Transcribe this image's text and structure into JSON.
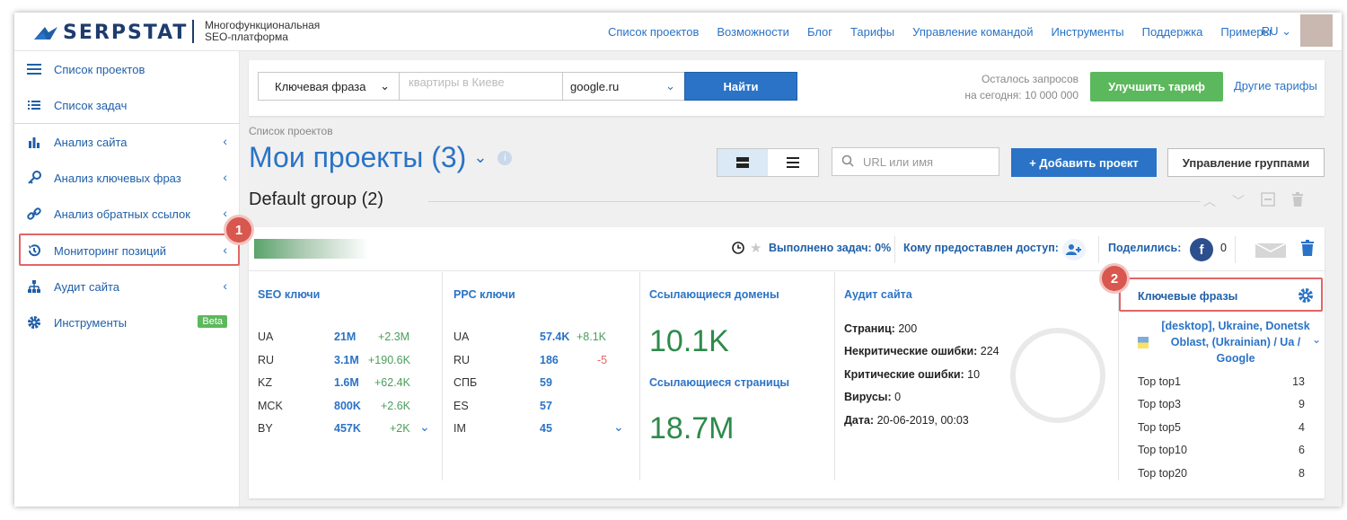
{
  "header": {
    "logo": "SERPSTAT",
    "subtitle_line1": "Многофункциональная",
    "subtitle_line2": "SEO-платформа",
    "nav": [
      "Список проектов",
      "Возможности",
      "Блог",
      "Тарифы",
      "Управление командой",
      "Инструменты",
      "Поддержка",
      "Примеры"
    ],
    "lang": "RU"
  },
  "sidebar": {
    "items": [
      {
        "label": "Список проектов",
        "icon": "menu-icon"
      },
      {
        "label": "Список задач",
        "icon": "list-icon"
      },
      {
        "label": "Анализ сайта",
        "icon": "chart-icon"
      },
      {
        "label": "Анализ ключевых фраз",
        "icon": "key-icon"
      },
      {
        "label": "Анализ обратных ссылок",
        "icon": "link-icon"
      },
      {
        "label": "Мониторинг позиций",
        "icon": "history-icon"
      },
      {
        "label": "Аудит сайта",
        "icon": "sitemap-icon"
      },
      {
        "label": "Инструменты",
        "icon": "gear-icon"
      }
    ],
    "beta": "Beta"
  },
  "annotations": {
    "one": "1",
    "two": "2"
  },
  "search": {
    "type": "Ключевая фраза",
    "placeholder": "квартиры в Киеве",
    "engine": "google.ru",
    "find": "Найти",
    "quota_line1": "Осталось запросов",
    "quota_line2": "на сегодня: 10 000 000",
    "upgrade": "Улучшить тариф",
    "other": "Другие тарифы"
  },
  "page": {
    "breadcrumb": "Список проектов",
    "title": "Мои проекты (3)",
    "url_placeholder": "URL или имя",
    "add_project": "+ Добавить проект",
    "manage_groups": "Управление группами",
    "group_title": "Default group (2)"
  },
  "project": {
    "tasks": "Выполнено задач: 0%",
    "access": "Кому предоставлен доступ:",
    "shared": "Поделились:",
    "share_count": "0",
    "seo": {
      "title": "SEO ключи",
      "rows": [
        {
          "c": "UA",
          "v": "21M",
          "d": "+2.3M"
        },
        {
          "c": "RU",
          "v": "3.1M",
          "d": "+190.6K"
        },
        {
          "c": "KZ",
          "v": "1.6M",
          "d": "+62.4K"
        },
        {
          "c": "MCK",
          "v": "800K",
          "d": "+2.6K"
        },
        {
          "c": "BY",
          "v": "457K",
          "d": "+2K"
        }
      ]
    },
    "ppc": {
      "title": "PPC ключи",
      "rows": [
        {
          "c": "UA",
          "v": "57.4K",
          "d": "+8.1K"
        },
        {
          "c": "RU",
          "v": "186",
          "d": "-5"
        },
        {
          "c": "СПБ",
          "v": "59",
          "d": ""
        },
        {
          "c": "ES",
          "v": "57",
          "d": ""
        },
        {
          "c": "IM",
          "v": "45",
          "d": ""
        }
      ]
    },
    "links": {
      "domains_title": "Ссылающиеся домены",
      "domains_value": "10.1K",
      "pages_title": "Ссылающиеся страницы",
      "pages_value": "18.7M"
    },
    "audit": {
      "title": "Аудит сайта",
      "pages_l": "Страниц:",
      "pages_v": "200",
      "noncrit_l": "Некритические ошибки:",
      "noncrit_v": "224",
      "crit_l": "Критические ошибки:",
      "crit_v": "10",
      "virus_l": "Вирусы:",
      "virus_v": "0",
      "date_l": "Дата:",
      "date_v": "20-06-2019, 00:03"
    },
    "keywords": {
      "title": "Ключевые фразы",
      "region": "[desktop], Ukraine, Donetsk Oblast, (Ukrainian) / Ua / Google",
      "tops": [
        {
          "l": "Top top1",
          "v": "13"
        },
        {
          "l": "Top top3",
          "v": "9"
        },
        {
          "l": "Top top5",
          "v": "4"
        },
        {
          "l": "Top top10",
          "v": "6"
        },
        {
          "l": "Top top20",
          "v": "8"
        }
      ]
    }
  }
}
